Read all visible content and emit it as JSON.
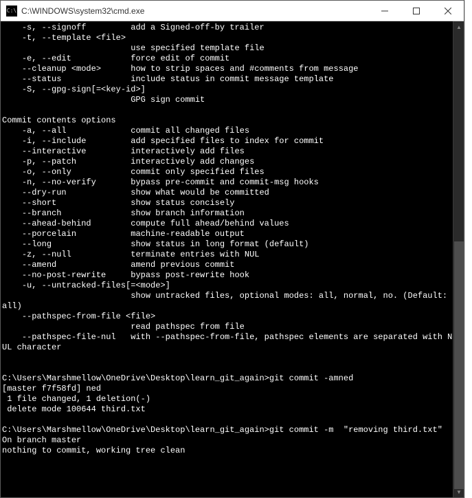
{
  "window": {
    "title": "C:\\WINDOWS\\system32\\cmd.exe",
    "icon_label": "C:\\"
  },
  "options_block1": [
    {
      "flags": "    -s, --signoff",
      "desc": "add a Signed-off-by trailer"
    },
    {
      "flags": "    -t, --template <file>",
      "desc": ""
    },
    {
      "flags": "",
      "desc": "use specified template file"
    },
    {
      "flags": "    -e, --edit",
      "desc": "force edit of commit"
    },
    {
      "flags": "    --cleanup <mode>",
      "desc": "how to strip spaces and #comments from message"
    },
    {
      "flags": "    --status",
      "desc": "include status in commit message template"
    },
    {
      "flags": "    -S, --gpg-sign[=<key-id>]",
      "desc": ""
    },
    {
      "flags": "",
      "desc": "GPG sign commit"
    }
  ],
  "section_header": "Commit contents options",
  "options_block2": [
    {
      "flags": "    -a, --all",
      "desc": "commit all changed files"
    },
    {
      "flags": "    -i, --include",
      "desc": "add specified files to index for commit"
    },
    {
      "flags": "    --interactive",
      "desc": "interactively add files"
    },
    {
      "flags": "    -p, --patch",
      "desc": "interactively add changes"
    },
    {
      "flags": "    -o, --only",
      "desc": "commit only specified files"
    },
    {
      "flags": "    -n, --no-verify",
      "desc": "bypass pre-commit and commit-msg hooks"
    },
    {
      "flags": "    --dry-run",
      "desc": "show what would be committed"
    },
    {
      "flags": "    --short",
      "desc": "show status concisely"
    },
    {
      "flags": "    --branch",
      "desc": "show branch information"
    },
    {
      "flags": "    --ahead-behind",
      "desc": "compute full ahead/behind values"
    },
    {
      "flags": "    --porcelain",
      "desc": "machine-readable output"
    },
    {
      "flags": "    --long",
      "desc": "show status in long format (default)"
    },
    {
      "flags": "    -z, --null",
      "desc": "terminate entries with NUL"
    },
    {
      "flags": "    --amend",
      "desc": "amend previous commit"
    },
    {
      "flags": "    --no-post-rewrite",
      "desc": "bypass post-rewrite hook"
    }
  ],
  "tail_lines": [
    "    -u, --untracked-files[=<mode>]",
    "                          show untracked files, optional modes: all, normal, no. (Default: all)",
    "    --pathspec-from-file <file>",
    "                          read pathspec from file",
    "    --pathspec-file-nul   with --pathspec-from-file, pathspec elements are separated with NUL character",
    "",
    "",
    "C:\\Users\\Marshmellow\\OneDrive\\Desktop\\learn_git_again>git commit -amned",
    "[master f7f58fd] ned",
    " 1 file changed, 1 deletion(-)",
    " delete mode 100644 third.txt",
    "",
    "C:\\Users\\Marshmellow\\OneDrive\\Desktop\\learn_git_again>git commit -m  \"removing third.txt\"",
    "On branch master",
    "nothing to commit, working tree clean"
  ],
  "flag_col_width": 26
}
